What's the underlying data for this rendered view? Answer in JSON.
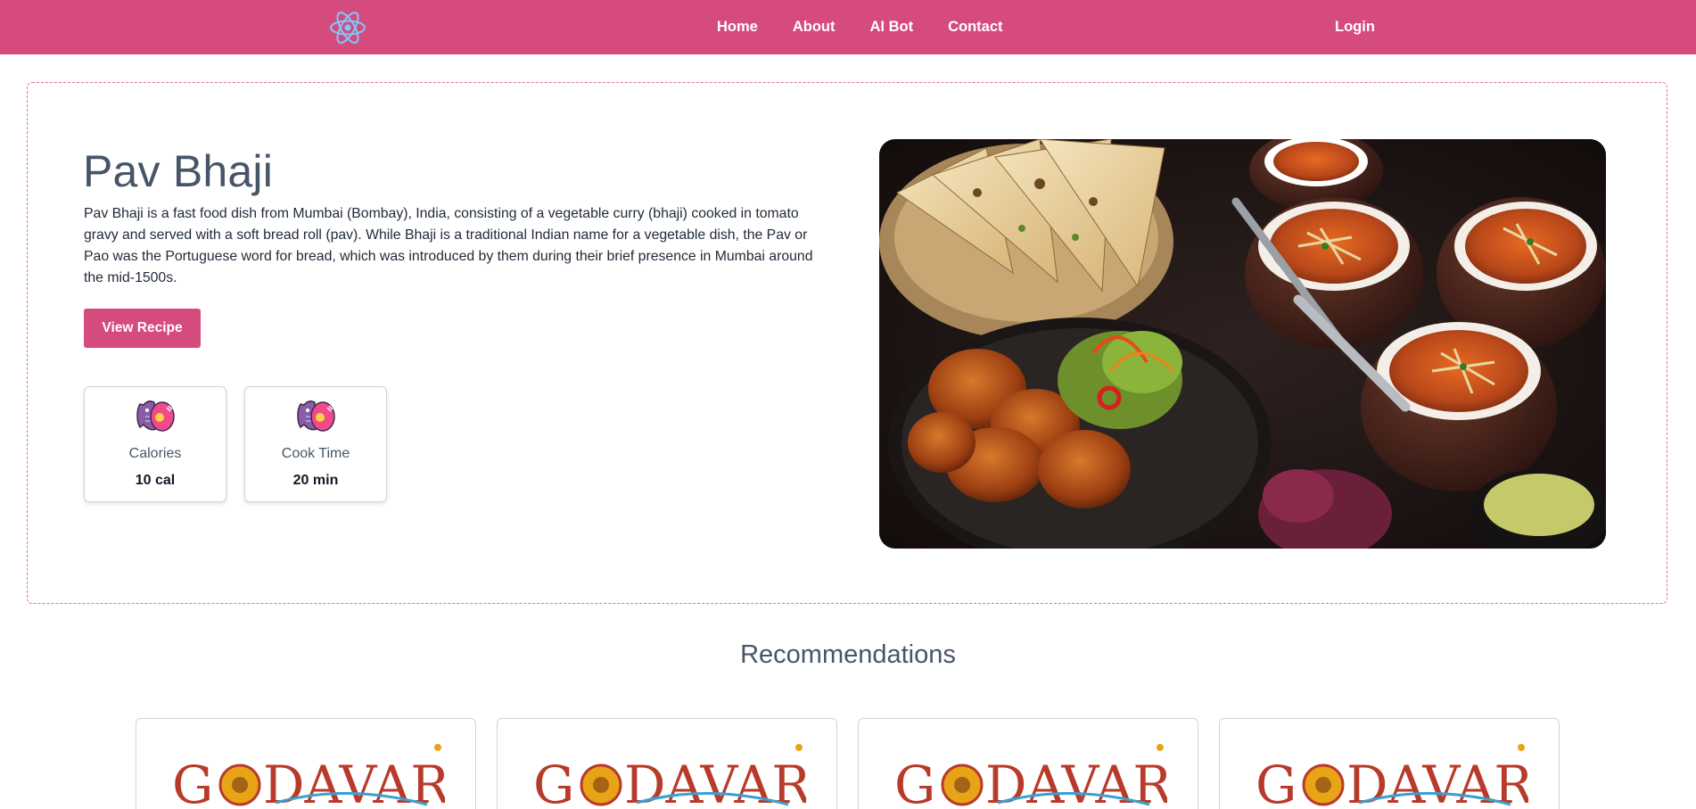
{
  "navbar": {
    "logo_icon": "react-atom-icon",
    "links": [
      {
        "label": "Home"
      },
      {
        "label": "About"
      },
      {
        "label": "AI Bot"
      },
      {
        "label": "Contact"
      }
    ],
    "login_label": "Login",
    "background_color": "#d64b7d"
  },
  "hero": {
    "title": "Pav Bhaji",
    "description": "Pav Bhaji is a fast food dish from Mumbai (Bombay), India, consisting of a vegetable curry (bhaji) cooked in tomato gravy and served with a soft bread roll (pav). While Bhaji is a traditional Indian name for a vegetable dish, the Pav or Pao was the Portuguese word for bread, which was introduced by them during their brief presence in Mumbai around the mid-1500s.",
    "button_label": "View Recipe",
    "stats": [
      {
        "icon": "fish-egg-icon",
        "label": "Calories",
        "value": "10 cal"
      },
      {
        "icon": "fish-egg-icon",
        "label": "Cook Time",
        "value": "20 min"
      }
    ],
    "image_icon": "indian-food-photo"
  },
  "recommendations": {
    "title": "Recommendations",
    "cards": [
      {
        "brand": "GODAVARI"
      },
      {
        "brand": "GODAVARI"
      },
      {
        "brand": "GODAVARI"
      },
      {
        "brand": "GODAVARI"
      }
    ]
  },
  "colors": {
    "accent": "#d64b7d",
    "heading": "#475569",
    "logo_red": "#b83a2a",
    "logo_gold": "#e8a317"
  }
}
